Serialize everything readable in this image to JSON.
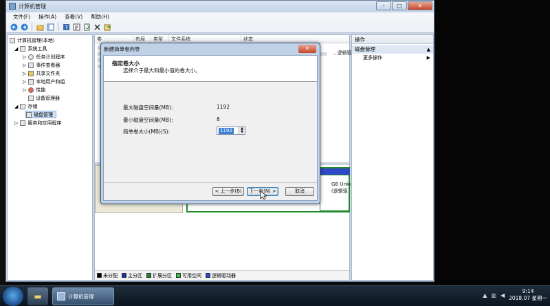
{
  "window": {
    "title": "计算机管理",
    "minimize": "–",
    "maximize": "□",
    "close": "✕"
  },
  "menu": [
    "文件(F)",
    "操作(A)",
    "查看(V)",
    "帮助(H)"
  ],
  "toolbar": [
    "back-icon",
    "forward-icon",
    "up-folder-icon",
    "show-hide-tree-icon",
    "help-icon",
    "properties-icon",
    "refresh-icon",
    "delete-icon",
    "export-icon"
  ],
  "tree": {
    "root": "计算机管理(本地)",
    "system_tools": "系统工具",
    "task_scheduler": "任务计划程序",
    "event_viewer": "事件查看器",
    "shared_folders": "共享文件夹",
    "local_users": "本地用户和组",
    "performance": "性能",
    "device_manager": "设备管理器",
    "storage": "存储",
    "disk_management": "磁盘管理",
    "services": "服务和应用程序"
  },
  "columns": [
    "卷",
    "布局",
    "类型",
    "文件系统",
    "状态"
  ],
  "list": {
    "status_cell": ", 逻辑驱动器"
  },
  "partition": {
    "text1": "GB Unkı",
    "text2": "(逻辑驱"
  },
  "legend": [
    {
      "label": "未分配",
      "color": "#000000"
    },
    {
      "label": "主分区",
      "color": "#1a2fa0"
    },
    {
      "label": "扩展分区",
      "color": "#1f8a2c"
    },
    {
      "label": "可用空间",
      "color": "#39c43b"
    },
    {
      "label": "逻辑驱动器",
      "color": "#2f47c8"
    }
  ],
  "actions": {
    "header": "操作",
    "section": "磁盘管理",
    "more": "更多操作",
    "caret_up": "▲",
    "caret_right": "▶"
  },
  "dialog": {
    "title": "新建简单卷向导",
    "close": "✕",
    "heading": "指定卷大小",
    "subheading": "选择介于最大和最小值的卷大小。",
    "max_label": "最大磁盘空间量(MB):",
    "max_value": "1192",
    "min_label": "最小磁盘空间量(MB):",
    "min_value": "8",
    "size_label": "简单卷大小(MB)(S):",
    "size_value": "1192",
    "back": "< 上一步(B)",
    "next": "下一步(N) >",
    "cancel": "取消"
  },
  "taskbar": {
    "app_label": "计算机管理",
    "time": "9:14",
    "date": "2018.07 星期一"
  }
}
